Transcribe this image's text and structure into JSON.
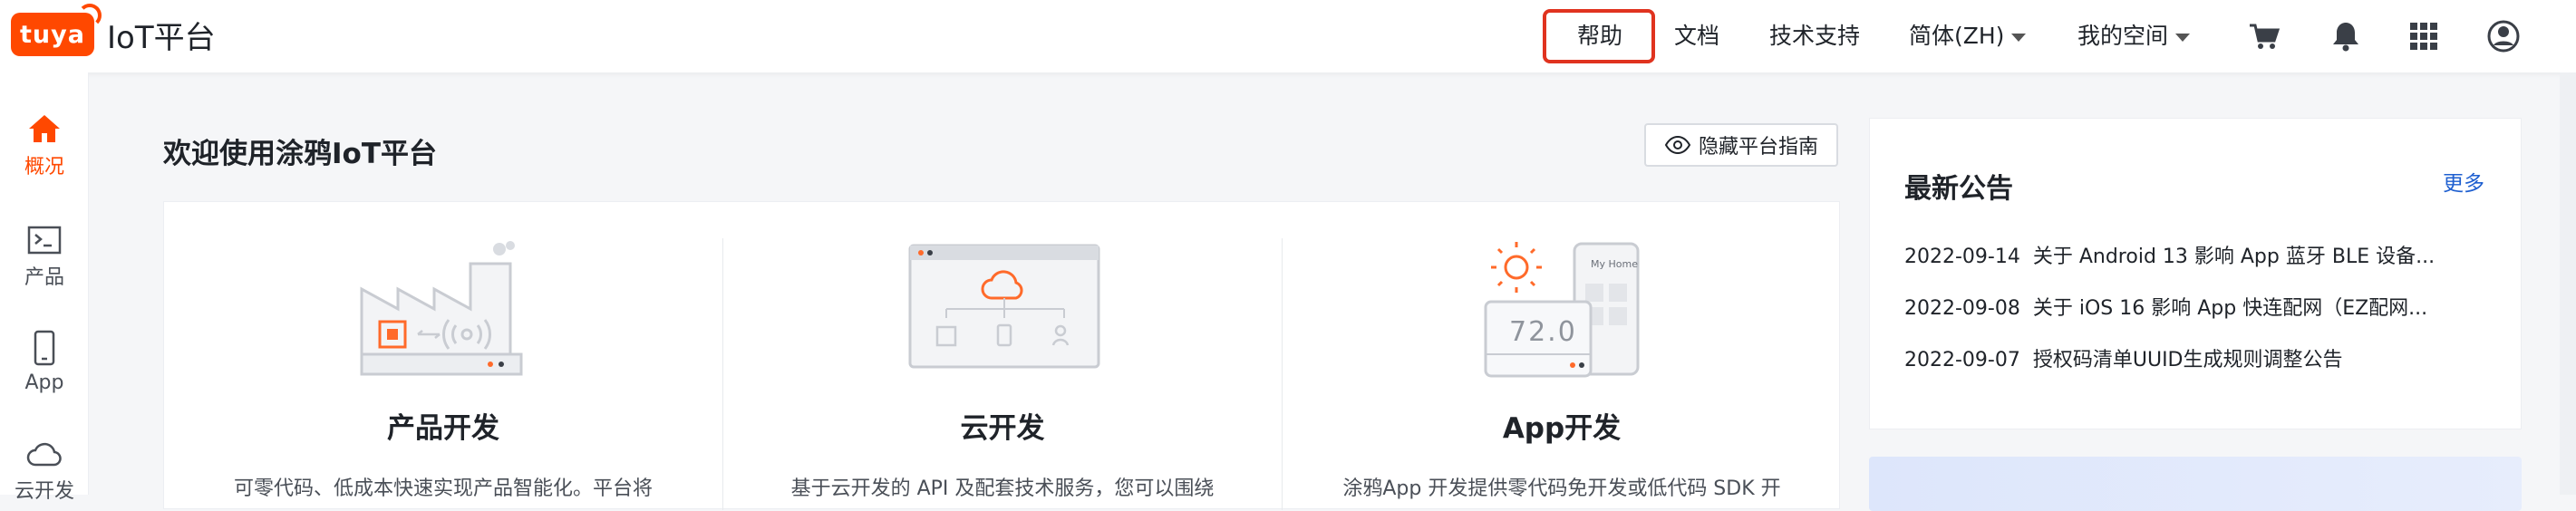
{
  "brand": {
    "logo_text": "tuya",
    "title": "IoT平台"
  },
  "nav": {
    "help": "帮助",
    "docs": "文档",
    "support": "技术支持",
    "language": "简体(ZH)",
    "space": "我的空间"
  },
  "icons": [
    "cart-icon",
    "bell-icon",
    "apps-grid-icon",
    "user-avatar-icon"
  ],
  "sidebar": {
    "items": [
      {
        "label": "概况",
        "icon": "home-icon",
        "active": true
      },
      {
        "label": "产品",
        "icon": "terminal-icon",
        "active": false
      },
      {
        "label": "App",
        "icon": "phone-icon",
        "active": false
      },
      {
        "label": "云开发",
        "icon": "cloud-icon",
        "active": false
      }
    ]
  },
  "main": {
    "welcome": "欢迎使用涂鸦IoT平台",
    "hide_guide": "隐藏平台指南",
    "cards": [
      {
        "title": "产品开发",
        "desc": "可零代码、低成本快速实现产品智能化。平台将"
      },
      {
        "title": "云开发",
        "desc": "基于云开发的 API 及配套技术服务，您可以围绕"
      },
      {
        "title": "App开发",
        "desc": "涂鸦App 开发提供零代码免开发或低代码 SDK 开"
      }
    ],
    "app_preview": {
      "label": "My Home",
      "temperature": "72.0"
    }
  },
  "notice": {
    "title": "最新公告",
    "more": "更多",
    "items": [
      {
        "date": "2022-09-14",
        "text": "关于 Android 13 影响 App 蓝牙 BLE 设备..."
      },
      {
        "date": "2022-09-08",
        "text": "关于 iOS 16 影响 App 快连配网（EZ配网..."
      },
      {
        "date": "2022-09-07",
        "text": "授权码清单UUID生成规则调整公告"
      }
    ]
  },
  "colors": {
    "brand": "#ff4800",
    "highlight": "#e0331f",
    "link": "#1e5fd0"
  }
}
